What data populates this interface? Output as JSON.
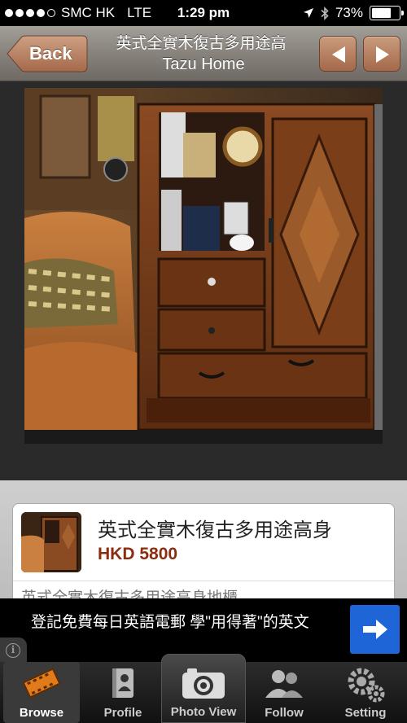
{
  "status_bar": {
    "carrier": "SMC HK",
    "network": "LTE",
    "time": "1:29 pm",
    "battery": "73%",
    "battery_level": 0.73,
    "signal_bars_filled": 4,
    "signal_bars_total": 5
  },
  "nav": {
    "back_label": "Back",
    "title": "英式全實木復古多用途高",
    "subtitle": "Tazu Home",
    "prev_icon": "triangle-left-icon",
    "next_icon": "triangle-right-icon",
    "accent_color": "#b37b5c"
  },
  "item": {
    "title": "英式全實木復古多用途高身",
    "price": "HKD 5800",
    "price_color": "#8b2d0f",
    "description": "英式全實木復古多用途高身地櫃"
  },
  "ad": {
    "text": "登記免費每日英語電郵 學\"用得著\"的英文",
    "button_icon": "arrow-right-icon",
    "button_color": "#1e66d8",
    "info_icon": "info-icon"
  },
  "tabs": [
    {
      "label": "Browse",
      "icon": "film-icon",
      "selected": true
    },
    {
      "label": "Profile",
      "icon": "profile-book-icon",
      "selected": false
    },
    {
      "label": "Photo View",
      "icon": "camera-icon",
      "selected": false
    },
    {
      "label": "Follow",
      "icon": "people-icon",
      "selected": false
    },
    {
      "label": "Setting",
      "icon": "gears-icon",
      "selected": false
    }
  ]
}
